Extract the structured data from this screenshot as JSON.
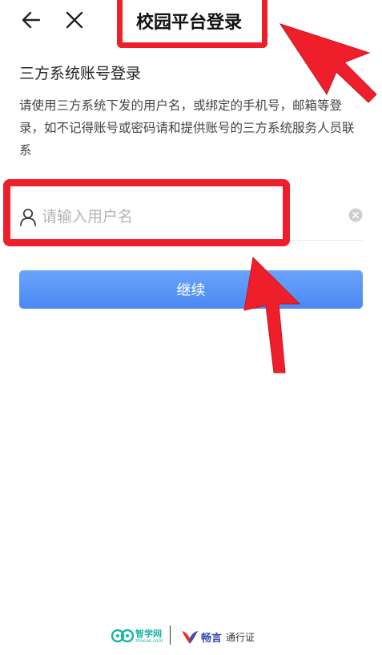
{
  "header": {
    "title": "校园平台登录",
    "back_icon": "arrow-left-icon",
    "close_icon": "close-icon"
  },
  "main": {
    "heading": "三方系统账号登录",
    "description": "请使用三方系统下发的用户名，或绑定的手机号，邮箱等登录，如不记得账号或密码请和提供账号的三方系统服务人员联系",
    "username": {
      "value": "",
      "placeholder": "请输入用户名",
      "icon": "user-icon"
    },
    "continue_label": "继续"
  },
  "footer": {
    "brand1_name": "智学网",
    "brand1_domain": "zhixue.com",
    "brand2_name": "畅言",
    "brand2_suffix": "通行证"
  },
  "colors": {
    "primary": "#4a89f3",
    "annotation": "#ee1f2a"
  }
}
